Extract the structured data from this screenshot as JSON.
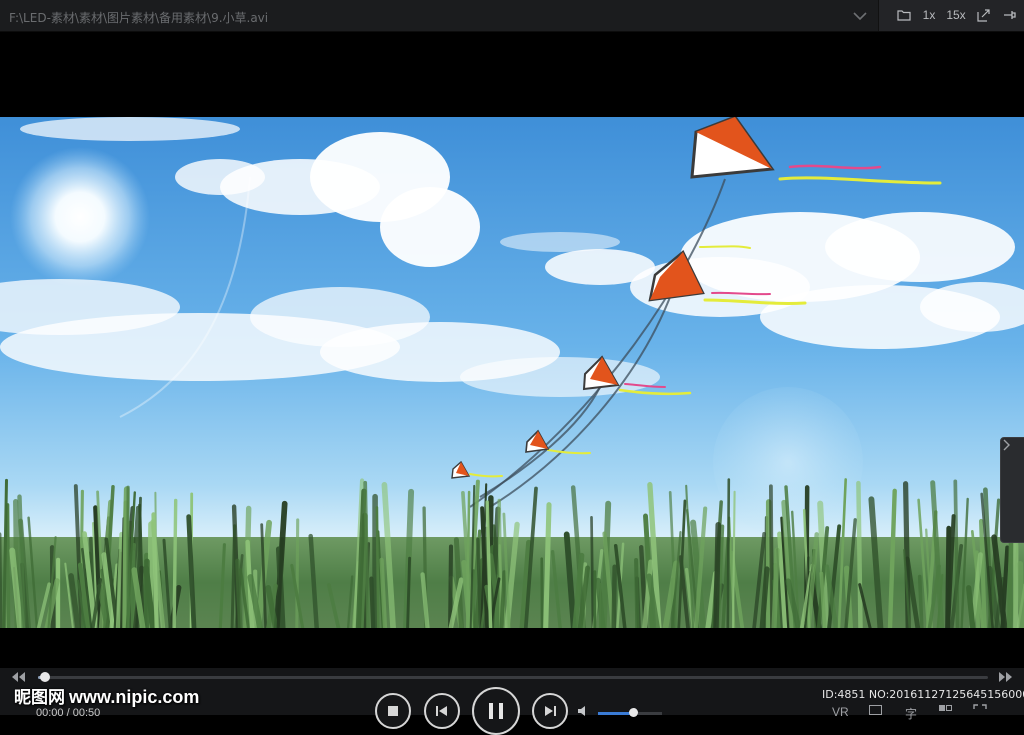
{
  "titlebar": {
    "file_path": "F:\\LED-素材\\素材\\图片素材\\备用素材\\9.小草.avi",
    "speed_1x": "1x",
    "speed_15x": "15x"
  },
  "icons": {
    "folder": "folder-icon",
    "screenshot": "screenshot-icon",
    "pin": "pin-icon"
  },
  "playback": {
    "current_time": "00:00",
    "total_time": "00:50",
    "progress": 0.004,
    "volume": 0.55
  },
  "watermark": {
    "brand": "昵图网",
    "site": "www.nipic.com",
    "id_text": "ID:4851 NO:20161127125645156000"
  },
  "bottom_right": {
    "vr": "VR",
    "subtitle": "字"
  },
  "colors": {
    "accent": "#3a7bd5",
    "titlebar_bg": "#1b1c1e",
    "kite_orange": "#e2541c"
  }
}
